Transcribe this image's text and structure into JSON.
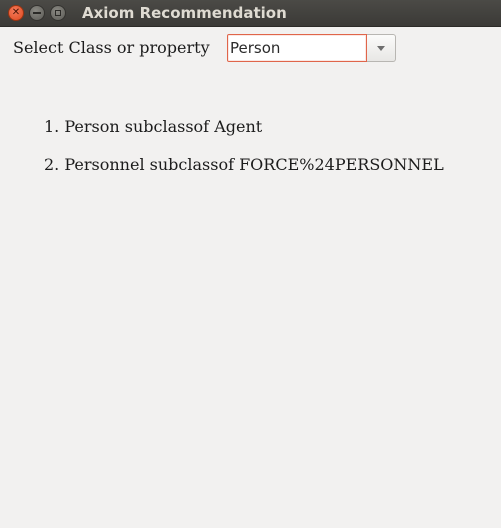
{
  "window": {
    "title": "Axiom Recommendation",
    "controls": {
      "close_icon": "close-icon",
      "minimize_icon": "minimize-icon",
      "maximize_icon": "maximize-icon"
    }
  },
  "form": {
    "label": "Select Class or property",
    "combo_value": "Person",
    "dropdown_icon": "chevron-down-icon"
  },
  "results": [
    "1. Person subclassof Agent",
    "2. Personnel subclassof FORCE%24PERSONNEL"
  ],
  "colors": {
    "titlebar": "#3b3a37",
    "title_text": "#dfdbd2",
    "close_button": "#df4a20",
    "background": "#f2f1f0",
    "focus_border": "#e0654a"
  }
}
